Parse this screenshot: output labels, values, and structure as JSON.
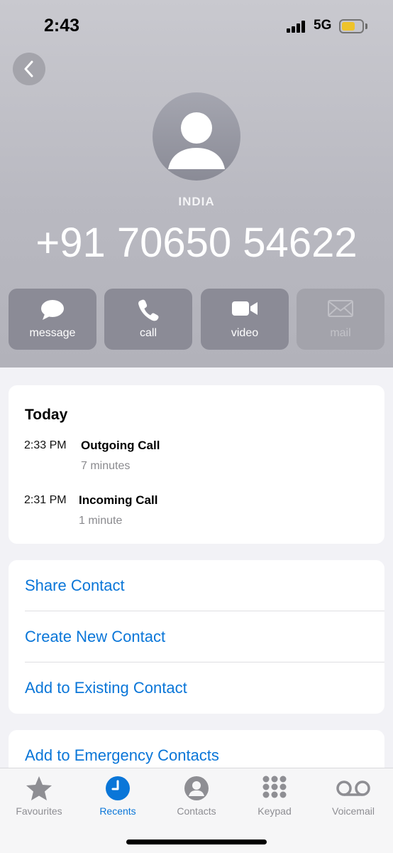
{
  "status_bar": {
    "time": "2:43",
    "network": "5G"
  },
  "contact": {
    "country": "INDIA",
    "phone_number": "+91 70650 54622"
  },
  "actions": [
    {
      "label": "message",
      "icon": "message-bubble-icon",
      "enabled": true
    },
    {
      "label": "call",
      "icon": "phone-icon",
      "enabled": true
    },
    {
      "label": "video",
      "icon": "video-camera-icon",
      "enabled": true
    },
    {
      "label": "mail",
      "icon": "mail-envelope-icon",
      "enabled": false
    }
  ],
  "recents": {
    "heading": "Today",
    "calls": [
      {
        "time": "2:33 PM",
        "type": "Outgoing Call",
        "duration": "7 minutes"
      },
      {
        "time": "2:31 PM",
        "type": "Incoming Call",
        "duration": "1 minute"
      }
    ]
  },
  "options": {
    "share_contact": "Share Contact",
    "create_new_contact": "Create New Contact",
    "add_to_existing_contact": "Add to Existing Contact",
    "add_to_emergency_contacts": "Add to Emergency Contacts"
  },
  "tabs": [
    {
      "label": "Favourites",
      "icon": "star-icon",
      "active": false
    },
    {
      "label": "Recents",
      "icon": "clock-icon",
      "active": true
    },
    {
      "label": "Contacts",
      "icon": "person-circle-icon",
      "active": false
    },
    {
      "label": "Keypad",
      "icon": "keypad-icon",
      "active": false
    },
    {
      "label": "Voicemail",
      "icon": "voicemail-icon",
      "active": false
    }
  ],
  "colors": {
    "accent": "#0a76d8",
    "header_bg": "#bdbdc4",
    "action_bg": "#8b8b96",
    "battery": "#f3c31a"
  }
}
